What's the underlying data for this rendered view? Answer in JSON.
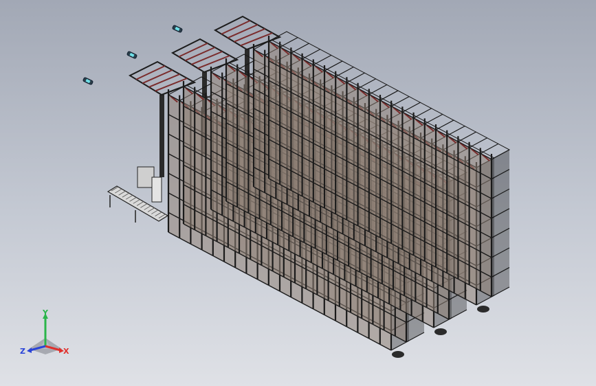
{
  "viewport": {
    "background_top": "#a2a8b5",
    "background_bottom": "#dfe1e6"
  },
  "model": {
    "aisle_count": 3,
    "bays_per_aisle": 20,
    "rack_frame_color": "#1a1a1a",
    "rack_panel_color": "#8f8277",
    "beam_accent_color": "#7a2c2c"
  },
  "lights": [
    {
      "name": "light-icon"
    },
    {
      "name": "light-icon"
    },
    {
      "name": "light-icon"
    }
  ],
  "triad": {
    "x_label": "X",
    "y_label": "Y",
    "z_label": "Z",
    "x_color": "#e0302c",
    "y_color": "#2ab54a",
    "z_color": "#2a44d8"
  }
}
